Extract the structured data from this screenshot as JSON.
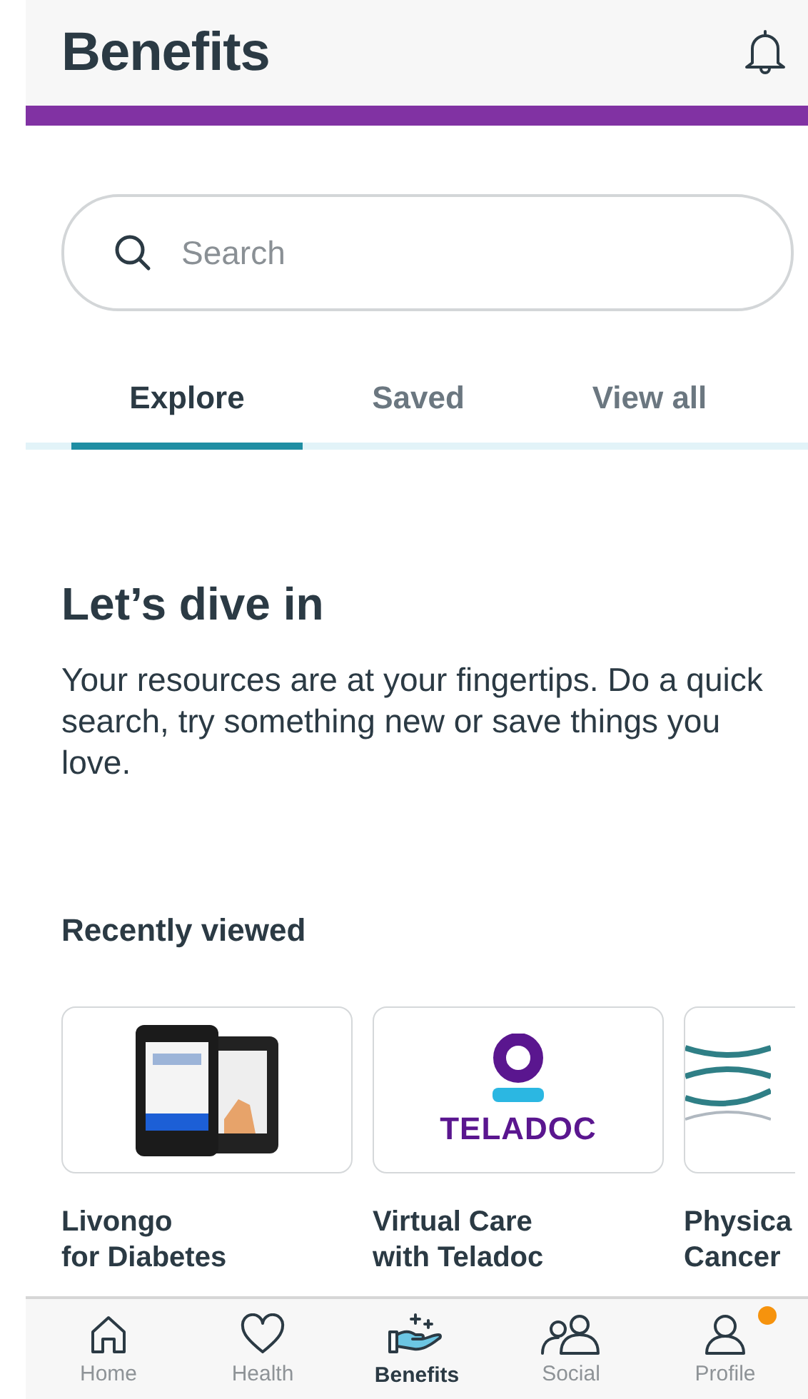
{
  "header": {
    "title": "Benefits"
  },
  "search": {
    "placeholder": "Search"
  },
  "tabs": [
    {
      "label": "Explore",
      "selected": true
    },
    {
      "label": "Saved",
      "selected": false
    },
    {
      "label": "View all",
      "selected": false
    }
  ],
  "intro": {
    "heading": "Let’s dive in",
    "text": "Your resources are at your fingertips. Do a quick search, try something new or save things you love."
  },
  "recently_viewed": {
    "heading": "Recently viewed",
    "cards": [
      {
        "kind": "device",
        "title": [
          "Livongo",
          "for Diabetes"
        ]
      },
      {
        "kind": "logo",
        "logo_text": "TELADOC",
        "title": [
          "Virtual Care",
          "with Teladoc"
        ]
      },
      {
        "kind": "photo",
        "title": [
          "Physica",
          "Cancer"
        ]
      }
    ]
  },
  "nav": [
    {
      "kind": "home",
      "label": "Home",
      "selected": false,
      "badge": false
    },
    {
      "kind": "health",
      "label": "Health",
      "selected": false,
      "badge": false
    },
    {
      "kind": "benefits",
      "label": "Benefits",
      "selected": true,
      "badge": false
    },
    {
      "kind": "social",
      "label": "Social",
      "selected": false,
      "badge": false
    },
    {
      "kind": "profile",
      "label": "Profile",
      "selected": false,
      "badge": true
    }
  ]
}
